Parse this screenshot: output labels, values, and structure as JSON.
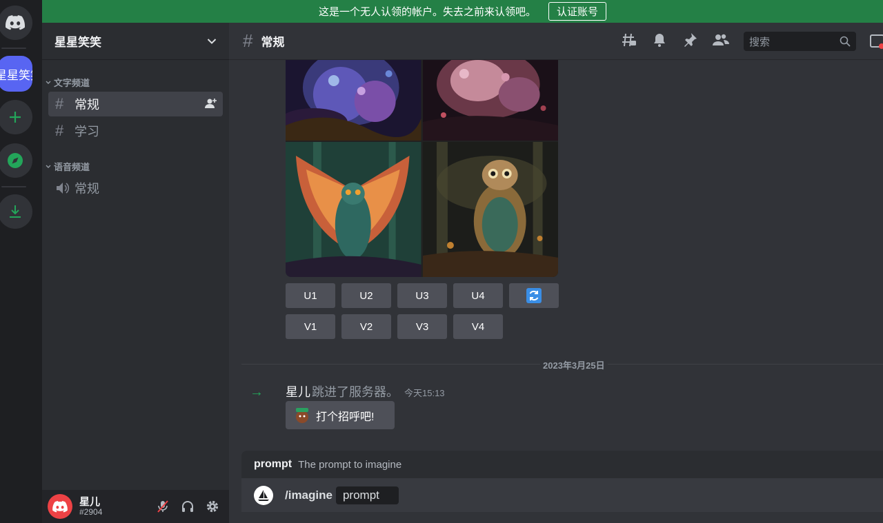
{
  "notice": {
    "text": "这是一个无人认领的帐户。失去之前来认领吧。",
    "button": "认证账号"
  },
  "rail": {
    "server_label": "星星笑笑"
  },
  "server": {
    "name": "星星笑笑"
  },
  "categories": {
    "text": "文字频道",
    "voice": "语音频道"
  },
  "channels": {
    "general": "常规",
    "study": "学习",
    "voice_general": "常规"
  },
  "header": {
    "channel": "常规",
    "search_placeholder": "搜索"
  },
  "buttons": {
    "upscale": [
      "U1",
      "U2",
      "U3",
      "U4"
    ],
    "variation": [
      "V1",
      "V2",
      "V3",
      "V4"
    ]
  },
  "divider": {
    "date": "2023年3月25日"
  },
  "join": {
    "user": "星儿",
    "text": "跳进了服务器。",
    "time": "今天15:13",
    "wave": "打个招呼吧!"
  },
  "composer": {
    "option_name": "prompt",
    "option_desc": "The prompt to imagine",
    "command": "/imagine",
    "option_chip": "prompt"
  },
  "user": {
    "name": "星儿",
    "tag": "#2904"
  },
  "colors": {
    "accent": "#5865f2",
    "green": "#248046",
    "online": "#23a55a",
    "danger": "#ed4245"
  }
}
